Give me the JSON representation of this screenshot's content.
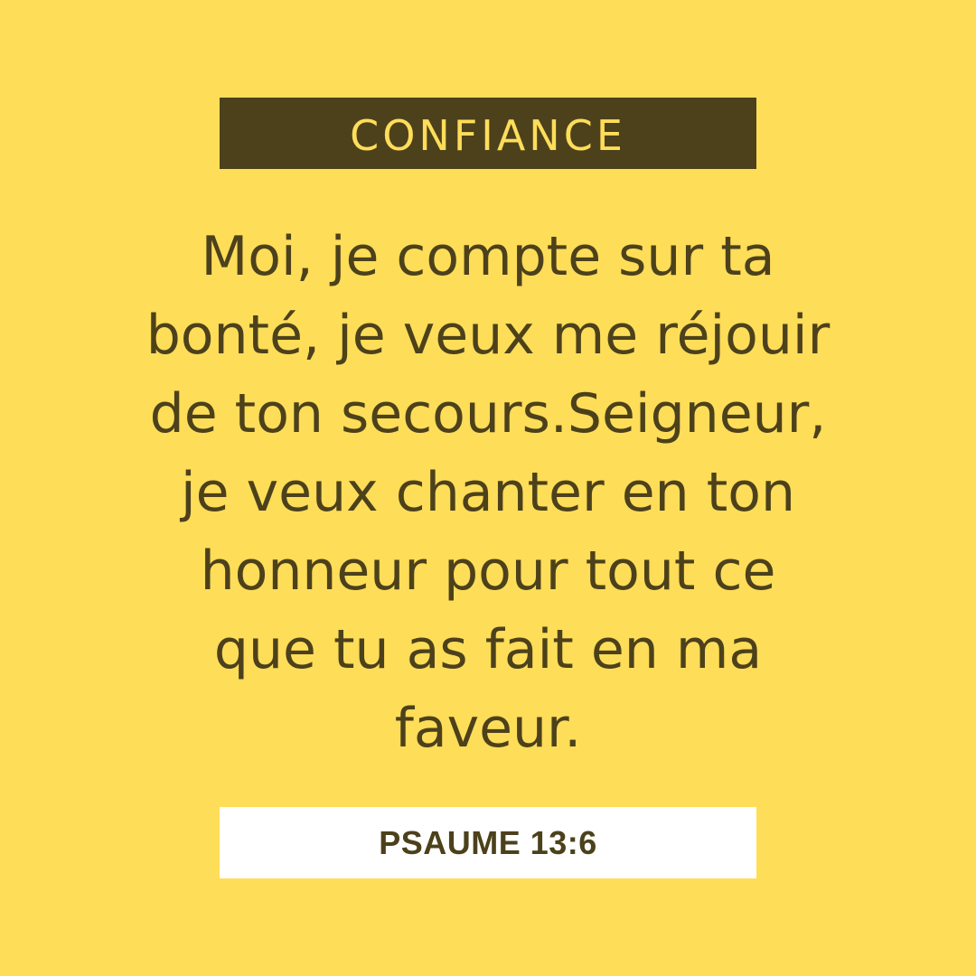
{
  "theme": {
    "label": "CONFIANCE"
  },
  "verse": {
    "lines": [
      "Moi, je compte sur ta",
      "bonté, je veux me réjouir",
      "de ton secours.Seigneur,",
      "je veux chanter en ton",
      "honneur pour tout ce",
      "que tu as fait en ma",
      "faveur."
    ]
  },
  "reference": {
    "label": "PSAUME 13:6"
  },
  "colors": {
    "background": "#FEDD59",
    "dark": "#4C411B",
    "reference_background": "#FFFFFF"
  }
}
